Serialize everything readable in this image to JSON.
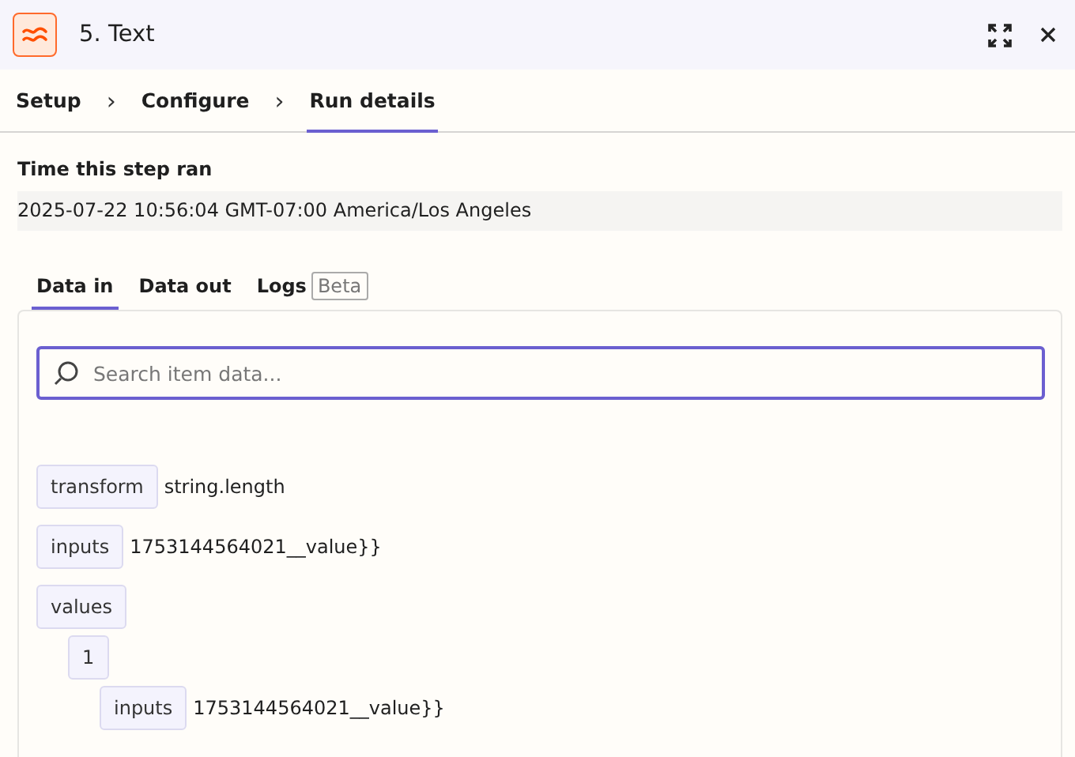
{
  "header": {
    "title": "5. Text"
  },
  "steps": [
    {
      "label": "Setup",
      "selected": false
    },
    {
      "label": "Configure",
      "selected": false
    },
    {
      "label": "Run details",
      "selected": true
    }
  ],
  "step_separator": "›",
  "run_time": {
    "label": "Time this step ran",
    "value": "2025-07-22 10:56:04 GMT-07:00 America/Los Angeles"
  },
  "data_tabs": [
    {
      "label": "Data in",
      "selected": true
    },
    {
      "label": "Data out",
      "selected": false
    },
    {
      "label": "Logs",
      "badge": "Beta",
      "selected": false
    }
  ],
  "search": {
    "placeholder": "Search item data..."
  },
  "tree": [
    {
      "key": "transform",
      "value": "string.length"
    },
    {
      "key": "inputs",
      "value": "1753144564021__value}}"
    },
    {
      "key": "values",
      "children": [
        {
          "key": "1",
          "children": [
            {
              "key": "inputs",
              "value": "1753144564021__value}}"
            }
          ]
        }
      ]
    }
  ]
}
